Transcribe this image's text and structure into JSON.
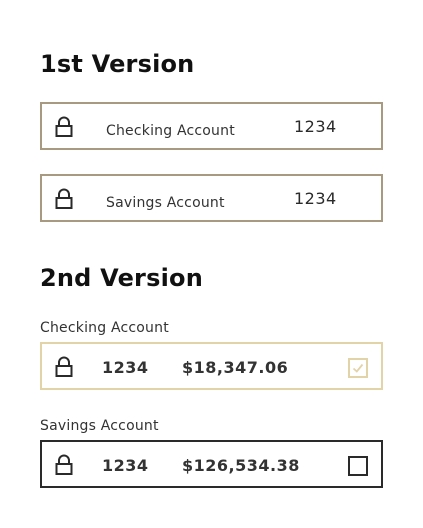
{
  "version1": {
    "heading": "1st Version",
    "accounts": [
      {
        "label": "Checking Account",
        "number": "1234",
        "icon": "lock-icon"
      },
      {
        "label": "Savings Account",
        "number": "1234",
        "icon": "lock-icon"
      }
    ]
  },
  "version2": {
    "heading": "2nd Version",
    "accounts": [
      {
        "label": "Checking Account",
        "number": "1234",
        "amount": "$18,347.06",
        "checked": true,
        "icon": "lock-icon"
      },
      {
        "label": "Savings Account",
        "number": "1234",
        "amount": "$126,534.38",
        "checked": false,
        "icon": "lock-icon"
      }
    ]
  },
  "colors": {
    "v1_border": "#a89a80",
    "v2_selected_border": "#e2d3a8",
    "v2_unselected_border": "#2a2a2a"
  }
}
